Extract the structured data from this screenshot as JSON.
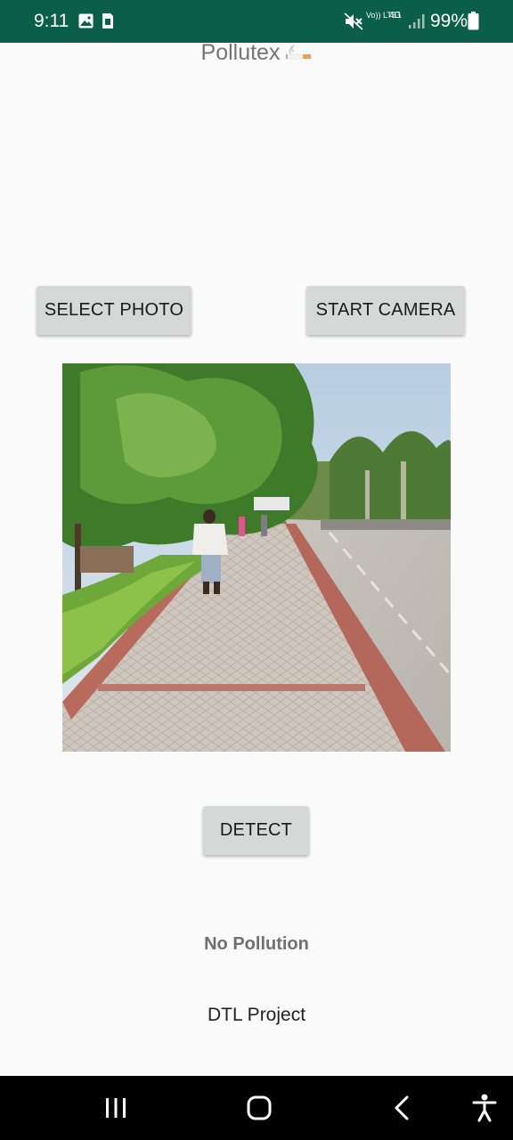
{
  "status_bar": {
    "time": "9:11",
    "network_volte": "Vo)) LTE1",
    "network_type": "4G",
    "battery": "99%",
    "icons": [
      "gallery-icon",
      "sim-icon",
      "mute-icon",
      "signal-icon",
      "battery-icon"
    ]
  },
  "app": {
    "title": "Pollutex",
    "title_emoji": "cigarette-icon"
  },
  "buttons": {
    "select_photo": "SELECT PHOTO",
    "start_camera": "START CAMERA",
    "detect": "DETECT"
  },
  "result": {
    "text": "No Pollution"
  },
  "footer": {
    "text": "DTL Project"
  },
  "nav": {
    "icons": [
      "recents-icon",
      "home-icon",
      "back-icon",
      "accessibility-icon"
    ]
  },
  "colors": {
    "status_bar": "#0b5e47",
    "background": "#fafafa",
    "button": "#d6d7d7"
  }
}
